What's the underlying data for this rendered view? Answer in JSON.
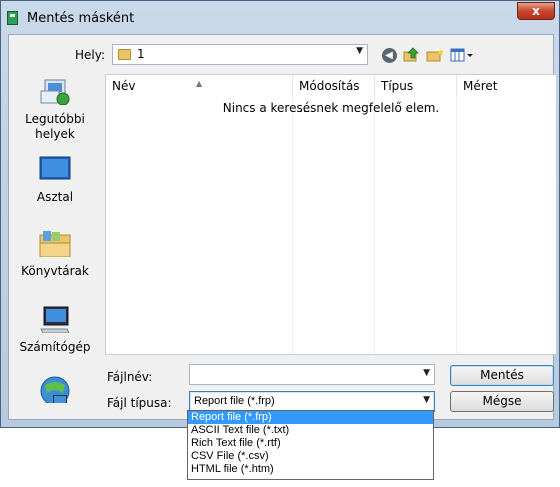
{
  "window": {
    "title": "Mentés másként",
    "close_label": "x"
  },
  "location": {
    "label": "Hely:",
    "value": "1"
  },
  "toolbar": {
    "icons": [
      "back-icon",
      "up-folder-icon",
      "new-folder-icon",
      "view-menu-icon"
    ]
  },
  "sidebar": {
    "items": [
      {
        "label": "Legutóbbi helyek",
        "icon": "recent-places-icon"
      },
      {
        "label": "Asztal",
        "icon": "desktop-icon"
      },
      {
        "label": "Könyvtárak",
        "icon": "libraries-icon"
      },
      {
        "label": "Számítógép",
        "icon": "computer-icon"
      },
      {
        "label": "",
        "icon": "network-icon"
      }
    ]
  },
  "filelist": {
    "columns": [
      "Név",
      "Módosítás ...",
      "Típus",
      "Méret"
    ],
    "empty_message": "Nincs a keresésnek megfelelő elem."
  },
  "form": {
    "filename_label": "Fájlnév:",
    "filename_value": "",
    "filetype_label": "Fájl típusa:",
    "filetype_value": "Report file (*.frp)",
    "save_label": "Mentés",
    "cancel_label": "Mégse"
  },
  "filetype_options": [
    "Report file (*.frp)",
    "ASCII Text file (*.txt)",
    "Rich Text file (*.rtf)",
    "CSV File (*.csv)",
    "HTML file (*.htm)"
  ],
  "colors": {
    "selection": "#3399ff",
    "title_close": "#c8452c"
  }
}
